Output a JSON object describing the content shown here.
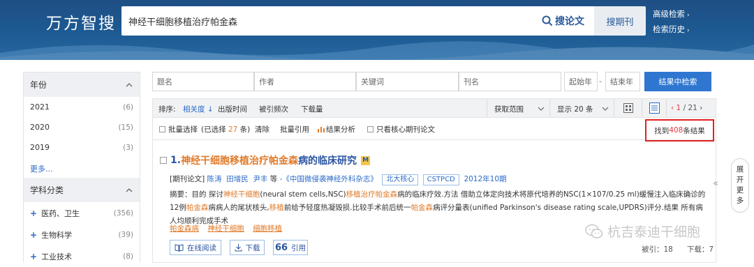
{
  "header": {
    "logo": "万方智搜",
    "search_value": "神经干细胞移植治疗帕金森",
    "search_paper": "搜论文",
    "search_journal": "搜期刊",
    "advanced": "高级检索",
    "history": "检索历史"
  },
  "sidebar": {
    "year": {
      "title": "年份",
      "items": [
        {
          "label": "2021",
          "count": "(6)"
        },
        {
          "label": "2020",
          "count": "(15)"
        },
        {
          "label": "2019",
          "count": "(3)"
        }
      ],
      "more": "更多..."
    },
    "subject": {
      "title": "学科分类",
      "items": [
        {
          "label": "医药、卫生",
          "count": "(356)"
        },
        {
          "label": "生物科学",
          "count": "(39)"
        },
        {
          "label": "工业技术",
          "count": "(8)"
        }
      ]
    }
  },
  "filters": {
    "title": "题名",
    "author": "作者",
    "keyword": "关键词",
    "journal": "刊名",
    "start_year": "起始年",
    "dash": "-",
    "end_year": "结束年",
    "search_in_results": "结果中检索"
  },
  "sortbar": {
    "label": "排序:",
    "relevance": "相关度",
    "pub_time": "出版时间",
    "cited": "被引频次",
    "downloads": "下载量",
    "scope": "获取范围",
    "per_page": "显示 20 条",
    "page_current": "1",
    "page_total": "/ 21"
  },
  "toolbar": {
    "batch_select": "批量选择",
    "selected_note_prefix": "(已选择",
    "selected_count": "27",
    "selected_note_suffix": "条)",
    "clear": "清除",
    "batch_cite": "批量引用",
    "analysis": "结果分析",
    "core_only": "只看核心期刊论文",
    "found_prefix": "找到",
    "found_count": "408",
    "found_suffix": "条结果"
  },
  "result": {
    "number": "1.",
    "title_hl": "神经干细胞移植治疗帕金森",
    "title_rest": "病的临床研究",
    "badge": "M",
    "type": "[期刊论文]",
    "authors": [
      "陈涛",
      "田增民",
      "尹丰"
    ],
    "etal": "等",
    "journal": "-《中国微侵袭神经外科杂志》",
    "tags": [
      "北大核心",
      "CSTPCD"
    ],
    "issue": "2012年10期",
    "abstract_parts": [
      {
        "t": "摘要：目的 探讨",
        "h": false
      },
      {
        "t": "神经干细胞",
        "h": true
      },
      {
        "t": "(neural stem cells,NSC)",
        "h": false
      },
      {
        "t": "移植治疗帕金森",
        "h": true
      },
      {
        "t": "病的临床疗效.方法 借助立体定向技术将原代培养的NSC(1×107/0.25 ml)缓慢注入临床确诊的12例",
        "h": false
      },
      {
        "t": "帕金森",
        "h": true
      },
      {
        "t": "病病人的尾状核头,",
        "h": false
      },
      {
        "t": "移植",
        "h": true
      },
      {
        "t": "前给予轻度热凝毁损.比较手术前后统一",
        "h": false
      },
      {
        "t": "帕金森",
        "h": true
      },
      {
        "t": "病评分量表(unified Parkinson's disease rating scale,UPDRS)评分.结果 所有病人均顺利完成手术",
        "h": false
      }
    ],
    "keywords": [
      "帕金森病",
      "神经干细胞",
      "细胞移植"
    ],
    "read_online": "在线阅读",
    "download": "下载",
    "cite": "引用",
    "cited_label": "被引：",
    "cited_value": "18",
    "dl_label": "下载：",
    "dl_value": "7"
  },
  "expand_tab": [
    "展",
    "开",
    "更",
    "多"
  ],
  "watermark": "杭吉泰迪干细胞"
}
